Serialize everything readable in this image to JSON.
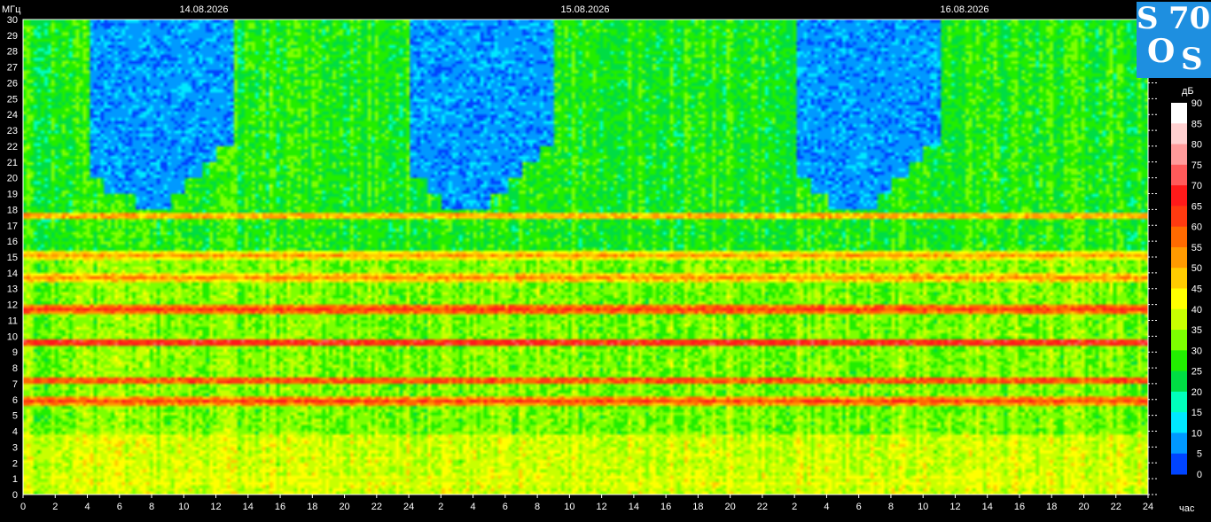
{
  "chart_data": {
    "type": "heatmap",
    "title": "",
    "y_unit": "МГц",
    "x_unit": "час",
    "dates": [
      "14.08.2026",
      "15.08.2026",
      "16.08.2026"
    ],
    "ylim": [
      0,
      30
    ],
    "y_ticks": [
      0,
      1,
      2,
      3,
      4,
      5,
      6,
      7,
      8,
      9,
      10,
      11,
      12,
      13,
      14,
      15,
      16,
      17,
      18,
      19,
      20,
      21,
      22,
      23,
      24,
      25,
      26,
      27,
      28,
      29,
      30
    ],
    "x_tick_labels": [
      "0",
      "2",
      "4",
      "6",
      "8",
      "10",
      "12",
      "14",
      "16",
      "18",
      "20",
      "22",
      "24",
      "2",
      "4",
      "6",
      "8",
      "10",
      "12",
      "14",
      "16",
      "18",
      "20",
      "22",
      "2",
      "4",
      "6",
      "8",
      "10",
      "12",
      "14",
      "16",
      "18",
      "20",
      "22",
      "24"
    ],
    "colorbar": {
      "unit": "дБ",
      "ticks": [
        90,
        85,
        80,
        75,
        70,
        65,
        60,
        55,
        50,
        45,
        40,
        35,
        30,
        25,
        20,
        15,
        10,
        5,
        0
      ],
      "colors": [
        "#ffffff",
        "#ffd0d0",
        "#ff9a9a",
        "#ff5a5a",
        "#ff1a1a",
        "#ff3a10",
        "#ff6a00",
        "#ff9a00",
        "#ffcc00",
        "#ffff00",
        "#c8ff00",
        "#7dff00",
        "#22ee00",
        "#00dd44",
        "#00ffbb",
        "#00e8ff",
        "#0099ff",
        "#0044ff",
        "#0000ee"
      ]
    },
    "persistent_bands_mhz": [
      0.8,
      1.2,
      6.0,
      7.3,
      9.7,
      11.8,
      13.8,
      15.2,
      17.7
    ],
    "band_levels_db": [
      48,
      46,
      70,
      72,
      78,
      72,
      62,
      60,
      62
    ],
    "muf_profile_mhz_by_hour": [
      30,
      30,
      30,
      30,
      20,
      19,
      19,
      18,
      18,
      19,
      20,
      21,
      22,
      30,
      30,
      30,
      30,
      30,
      30,
      30,
      30,
      30,
      30,
      30,
      20,
      19,
      18,
      18,
      18,
      19,
      20,
      21,
      22,
      30,
      30,
      30,
      30,
      30,
      30,
      30,
      30,
      30,
      30,
      30,
      30,
      30,
      30,
      30,
      20,
      19,
      18,
      18,
      18,
      19,
      20,
      21,
      22,
      30,
      30,
      30,
      30,
      30,
      30,
      30,
      30,
      30,
      30,
      30,
      30,
      30
    ]
  },
  "logo": {
    "l1": "S",
    "l2": "70",
    "l3": "O",
    "l4": "S"
  }
}
